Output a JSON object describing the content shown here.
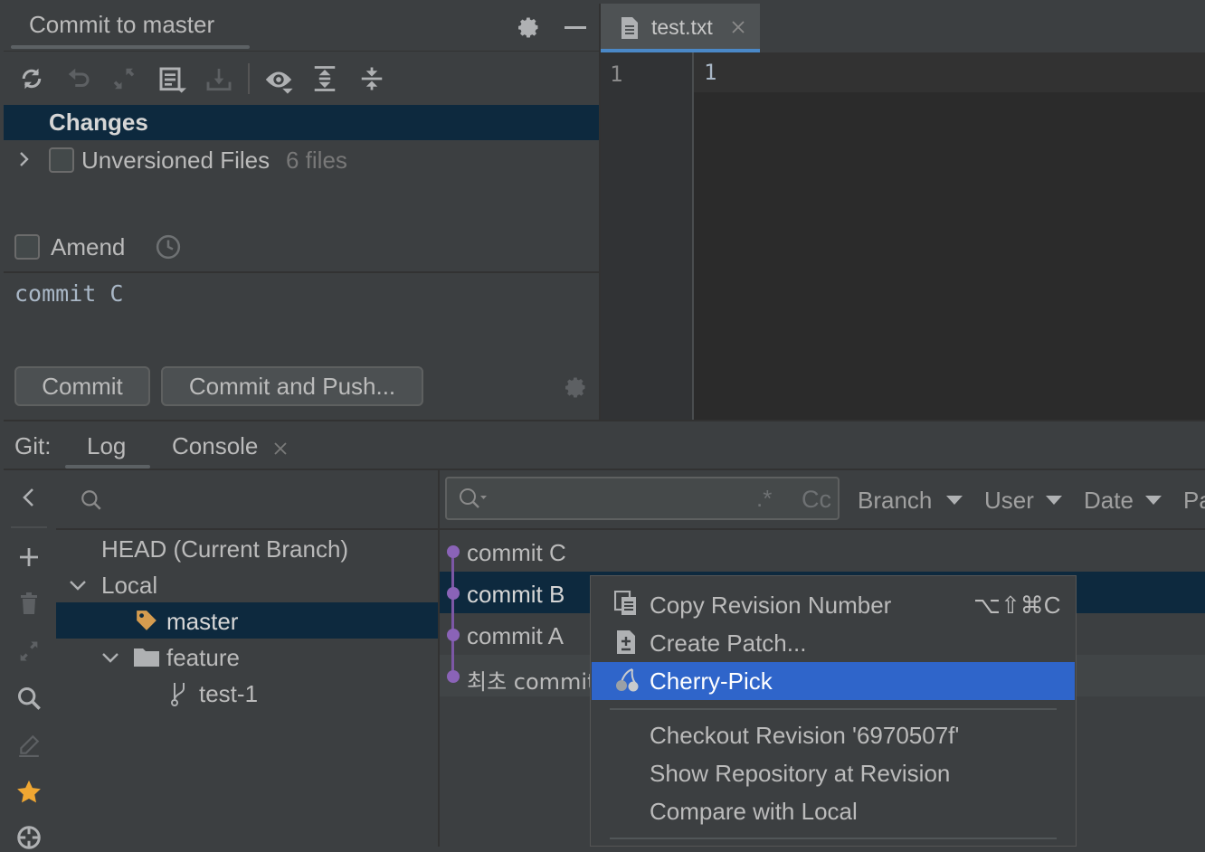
{
  "commit_panel": {
    "title": "Commit to master",
    "changes_label": "Changes",
    "unversioned_label": "Unversioned Files",
    "unversioned_count": "6 files",
    "amend_label": "Amend",
    "commit_message": "commit C",
    "commit_button": "Commit",
    "commit_push_button": "Commit and Push..."
  },
  "editor": {
    "tab_name": "test.txt",
    "gutter_line": "1",
    "content_line": "1"
  },
  "git": {
    "label": "Git:",
    "tabs": [
      "Log",
      "Console"
    ],
    "branches": {
      "head": "HEAD (Current Branch)",
      "local": "Local",
      "master": "master",
      "feature": "feature",
      "test1": "test-1"
    },
    "search_flags": {
      "regex": ".*",
      "case": "Cc"
    },
    "filters": [
      "Branch",
      "User",
      "Date",
      "Pa"
    ],
    "commits": [
      "commit C",
      "commit B",
      "commit A",
      "최초 commit"
    ]
  },
  "context_menu": {
    "items": [
      {
        "label": "Copy Revision Number",
        "shortcut": "⌥⇧⌘C"
      },
      {
        "label": "Create Patch..."
      },
      {
        "label": "Cherry-Pick"
      },
      {
        "label": "Checkout Revision '6970507f'"
      },
      {
        "label": "Show Repository at Revision"
      },
      {
        "label": "Compare with Local"
      }
    ],
    "highlight_color": "#2f65ca"
  },
  "colors": {
    "background": "#3c3f41",
    "selection": "#0d293e",
    "graph": "#8a63b7",
    "star": "#f0a732",
    "tag": "#d59c4f"
  }
}
